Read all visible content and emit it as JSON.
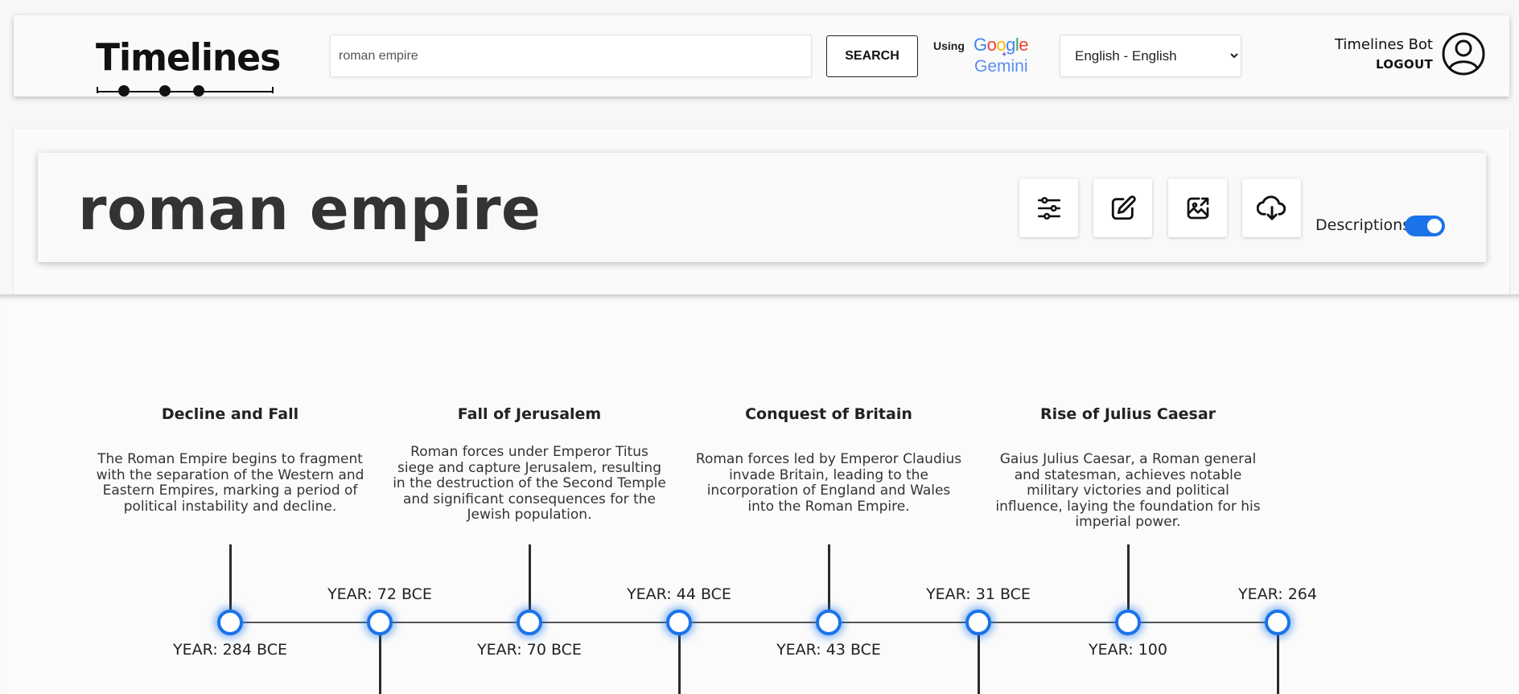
{
  "header": {
    "logo_text": "Timelines",
    "search": {
      "value": "roman empire",
      "placeholder": ""
    },
    "search_button": "SEARCH",
    "powered_by": {
      "using": "Using",
      "google": "Google",
      "gemini": "Gemini"
    },
    "language": {
      "selected": "English - English"
    },
    "user": {
      "name": "Timelines Bot",
      "logout": "LOGOUT"
    }
  },
  "title_section": {
    "title": "roman empire",
    "tools": [
      {
        "name": "filters",
        "icon": "sliders-icon"
      },
      {
        "name": "edit",
        "icon": "edit-icon"
      },
      {
        "name": "export-image",
        "icon": "image-export-icon"
      },
      {
        "name": "download",
        "icon": "cloud-download-icon"
      }
    ],
    "descriptions_toggle": {
      "label": "Descriptions",
      "on": true
    }
  },
  "timeline": {
    "accent_color": "#1a73e8",
    "events": [
      {
        "title": "Decline and Fall",
        "description": "The Roman Empire begins to fragment with the separation of the Western and Eastern Empires, marking a period of political instability and decline.",
        "year": "YEAR: 284 BCE"
      },
      {
        "title": "",
        "description": "",
        "year": "YEAR: 72 BCE"
      },
      {
        "title": "Fall of Jerusalem",
        "description": "Roman forces under Emperor Titus siege and capture Jerusalem, resulting in the destruction of the Second Temple and significant consequences for the Jewish population.",
        "year": "YEAR: 70 BCE"
      },
      {
        "title": "",
        "description": "",
        "year": "YEAR: 44 BCE"
      },
      {
        "title": "Conquest of Britain",
        "description": "Roman forces led by Emperor Claudius invade Britain, leading to the incorporation of England and Wales into the Roman Empire.",
        "year": "YEAR: 43 BCE"
      },
      {
        "title": "",
        "description": "",
        "year": "YEAR: 31 BCE"
      },
      {
        "title": "Rise of Julius Caesar",
        "description": "Gaius Julius Caesar, a Roman general and statesman, achieves notable military victories and political influence, laying the foundation for his imperial power.",
        "year": "YEAR: 100"
      },
      {
        "title": "",
        "description": "",
        "year": "YEAR: 264"
      }
    ]
  }
}
